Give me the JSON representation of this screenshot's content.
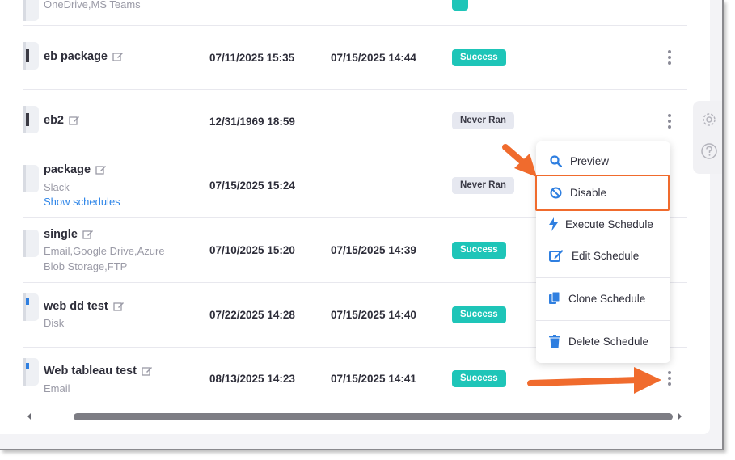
{
  "rows": [
    {
      "name": "",
      "sub": "OneDrive,MS Teams"
    },
    {
      "name": "eb package",
      "created": "07/11/2025 15:35",
      "last_run": "07/15/2025 14:44",
      "status": "Success"
    },
    {
      "name": "eb2",
      "created": "12/31/1969 18:59",
      "status": "Never Ran"
    },
    {
      "name": "package",
      "sub": "Slack",
      "link": "Show schedules",
      "created": "07/15/2025 15:24",
      "status": "Never Ran"
    },
    {
      "name": "single",
      "sub": "Email,Google Drive,Azure Blob Storage,FTP",
      "created": "07/10/2025 15:20",
      "last_run": "07/15/2025 14:39",
      "status": "Success"
    },
    {
      "name": "web dd test",
      "sub": "Disk",
      "created": "07/22/2025 14:28",
      "last_run": "07/15/2025 14:40",
      "status": "Success"
    },
    {
      "name": "Web tableau test",
      "sub": "Email",
      "created": "08/13/2025 14:23",
      "last_run": "07/15/2025 14:41",
      "status": "Success"
    }
  ],
  "context_menu": {
    "items": [
      {
        "label": "Preview",
        "icon": "search-icon"
      },
      {
        "label": "Disable",
        "icon": "ban-icon"
      },
      {
        "label": "Execute Schedule",
        "icon": "lightning-icon"
      },
      {
        "label": "Edit Schedule",
        "icon": "edit-icon"
      },
      {
        "label": "Clone Schedule",
        "icon": "copy-icon"
      },
      {
        "label": "Delete Schedule",
        "icon": "trash-icon"
      }
    ]
  },
  "side_tools": [
    {
      "icon": "gear-icon"
    },
    {
      "icon": "help-icon"
    }
  ],
  "colors": {
    "success": "#1ec5b8",
    "never_ran": "#e6e8f0",
    "accent": "#2f7fe0",
    "annotation": "#f06b2d"
  }
}
